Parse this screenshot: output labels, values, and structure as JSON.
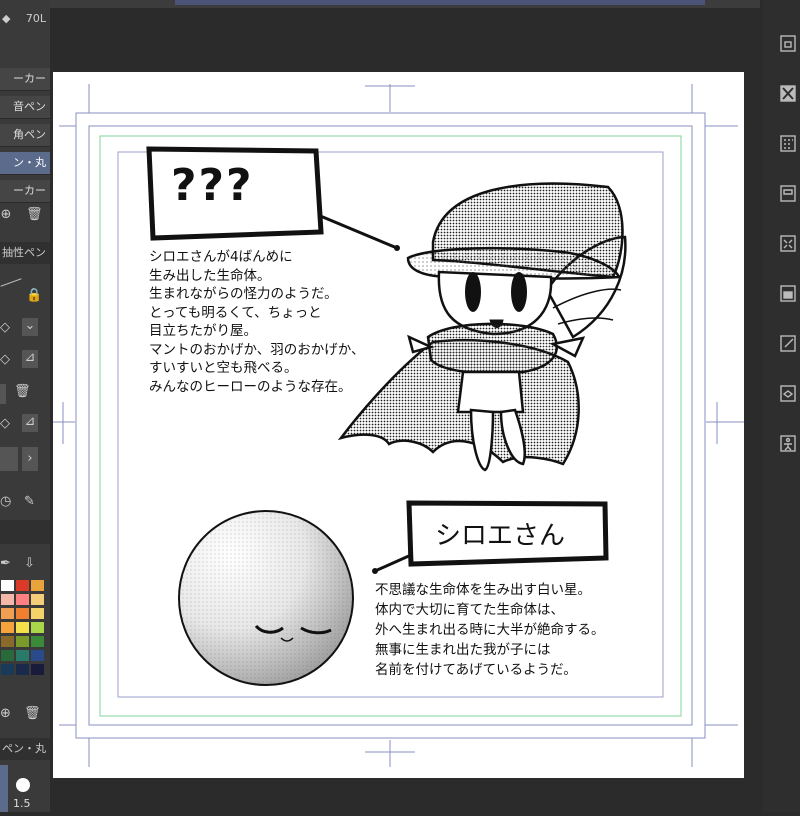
{
  "left_panel": {
    "size_label": "70L",
    "brushes": [
      "ーカー",
      "音ペン",
      "角ペン",
      "ン・丸",
      "ーカー"
    ],
    "selected_brush_index": 3,
    "property_title": "抽性ペン",
    "bottom_brush": "ペン・丸",
    "brush_size": "1.5"
  },
  "palette": [
    "#ffffff",
    "#d93a2a",
    "#e8a33a",
    "#f3b8a8",
    "#ff8080",
    "#f5cc7a",
    "#f0a050",
    "#f08030",
    "#f6d36a",
    "#f7a23a",
    "#f3e04a",
    "#a8d84a",
    "#8a6a2a",
    "#7a9a2a",
    "#3a8a3a",
    "#2a6a3a",
    "#2a7a6a",
    "#2a4a8a",
    "#1a3a5a",
    "#1a2a4a",
    "#1a1a3a"
  ],
  "right_toolbar": {
    "icons": [
      "layer-property-icon",
      "clear-layer-icon",
      "tone-icon",
      "frame-icon",
      "transform-icon",
      "fill-icon",
      "edit-icon",
      "3d-icon",
      "pose-icon"
    ]
  },
  "canvas": {
    "title_box_1": "???",
    "desc_1": [
      "シロエさんが4ばんめに",
      "生み出した生命体。",
      "生まれながらの怪力のようだ。",
      "とっても明るくて、ちょっと",
      "目立ちたがり屋。",
      "マントのおかげか、羽のおかげか、",
      "すいすいと空も飛べる。",
      "みんなのヒーローのような存在。"
    ],
    "title_box_2": "シロエさん",
    "desc_2": [
      "不思議な生命体を生み出す白い星。",
      "体内で大切に育てた生命体は、",
      "外へ生まれ出る時に大半が絶命する。",
      "無事に生まれ出た我が子には",
      "名前を付けてあげているようだ。"
    ]
  }
}
